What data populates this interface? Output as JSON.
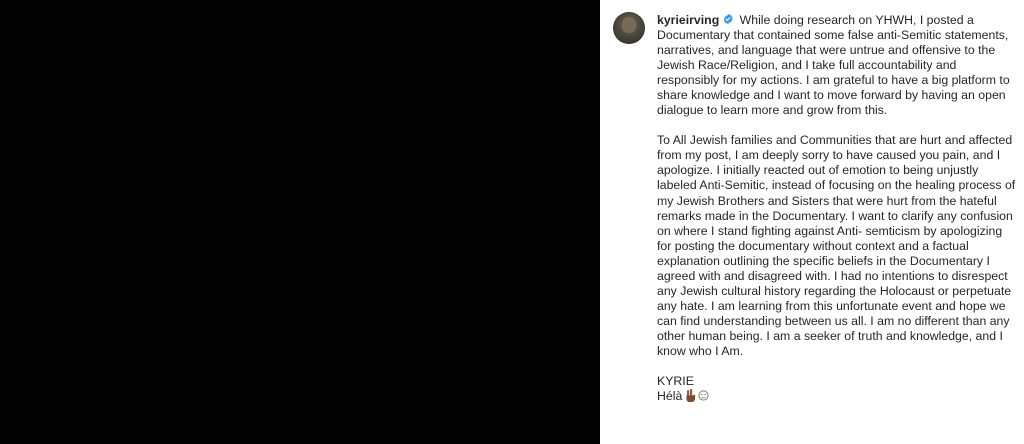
{
  "post": {
    "username": "kyrieirving",
    "verified_icon": "verified-badge-icon",
    "paragraph_1": "While doing research on YHWH, I posted a Documentary that contained some false anti-Semitic statements, narratives, and language that were untrue and offensive to the Jewish Race/Religion, and I take full accountability and responsibly for my actions. I am grateful to have a big platform to share knowledge and I want to move forward by having an open dialogue to learn more and grow from this.",
    "paragraph_2": "To All Jewish families and Communities that are hurt and affected from my post, I am deeply sorry to have caused you pain, and I apologize. I initially reacted out of emotion to being unjustly labeled Anti-Semitic, instead of focusing on the healing process of my Jewish Brothers and Sisters that were hurt from the hateful remarks made in the Documentary. I want to clarify any confusion on where I stand fighting against Anti- semticism by apologizing for posting the documentary without context and a factual explanation outlining the specific beliefs in the Documentary I agreed with and disagreed with. I had no intentions to disrespect any Jewish cultural history regarding the Holocaust or perpetuate any hate. I am learning from this unfortunate event and hope we can find understanding between us all. I am no different than any other human being. I am a seeker of truth and knowledge, and I know who I Am.",
    "signature_name": "KYRIE",
    "signature_line": "Hélà",
    "emoji_icons": [
      "hand-gesture-icon",
      "face-icon"
    ]
  },
  "colors": {
    "background": "#000000",
    "panel": "#ffffff",
    "text": "#262626",
    "verified": "#3897f0"
  }
}
